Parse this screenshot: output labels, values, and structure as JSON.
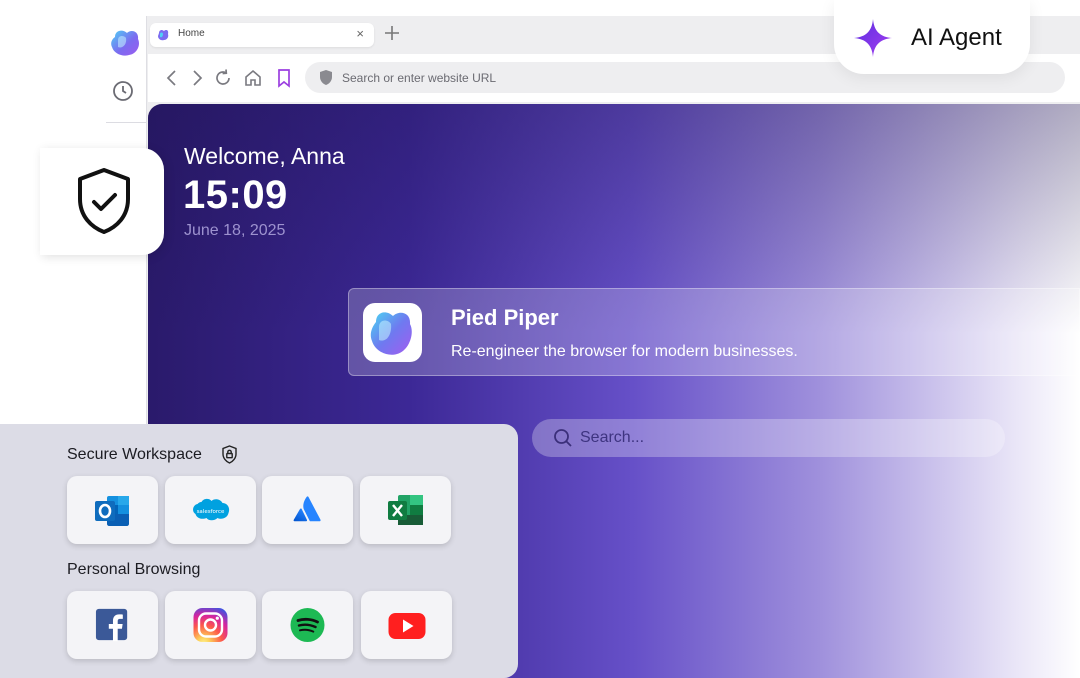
{
  "tab": {
    "title": "Home",
    "close": "×",
    "new_tab": "+"
  },
  "address_bar": {
    "placeholder": "Search or enter website URL"
  },
  "ai_agent": {
    "label": "AI Agent"
  },
  "greeting": {
    "welcome": "Welcome, Anna",
    "time": "15:09",
    "date": "June 18, 2025"
  },
  "promo": {
    "title": "Pied Piper",
    "subtitle": "Re-engineer the browser for modern businesses."
  },
  "search": {
    "placeholder": "Search..."
  },
  "sections": {
    "secure": {
      "label": "Secure Workspace",
      "apps": [
        "outlook-icon",
        "salesforce-icon",
        "atlassian-icon",
        "excel-icon"
      ],
      "salesforce_text": "salesforce"
    },
    "personal": {
      "label": "Personal Browsing",
      "apps": [
        "facebook-icon",
        "instagram-icon",
        "spotify-icon",
        "youtube-icon"
      ]
    }
  },
  "colors": {
    "hero_dark": "#2a1a6b",
    "hero_mid": "#6650c8",
    "accent_purple": "#7b3ff2",
    "panel_bg": "#dcdce6"
  }
}
